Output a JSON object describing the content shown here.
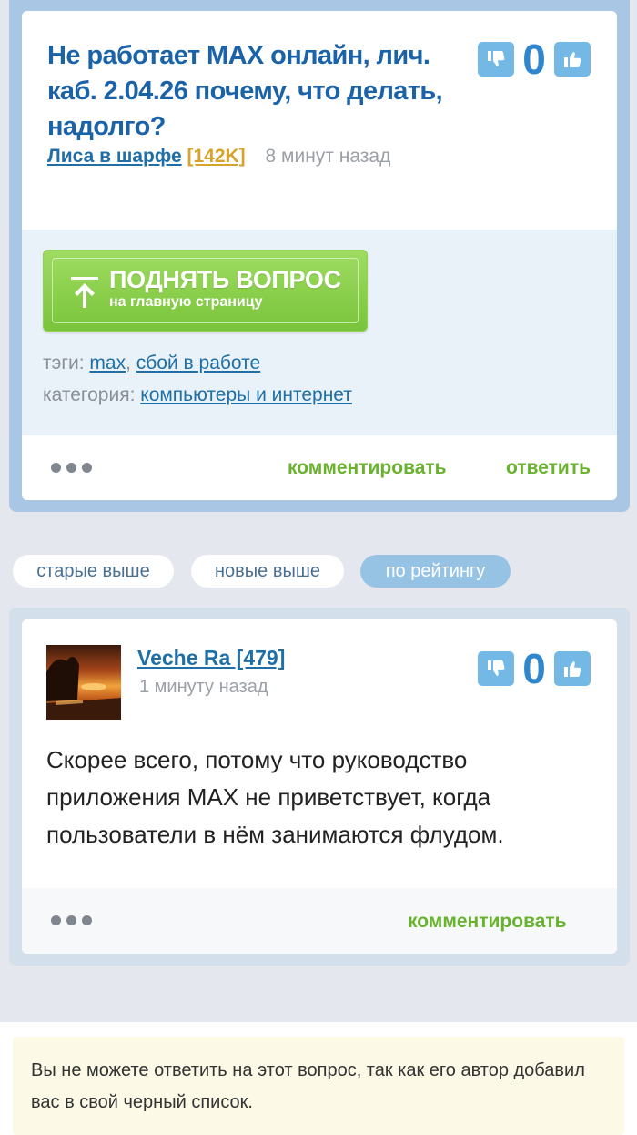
{
  "question": {
    "title": "Не работает MAX онлайн, лич. каб. 2.04.26 почему, что делать, надолго?",
    "author": "Лиса в шарфе",
    "author_karma": "[142K]",
    "time": "8 минут назад",
    "rating": "0",
    "raise_button": {
      "label": "ПОДНЯТЬ ВОПРОС",
      "sublabel": "на главную страницу"
    },
    "tags_label": "тэги:",
    "tags": [
      "max",
      "сбой в работе"
    ],
    "tags_separator": ",",
    "category_label": "категория:",
    "category": "компьютеры и интернет",
    "comment_label": "комментировать",
    "answer_label": "ответить"
  },
  "sort": {
    "options": [
      "старые выше",
      "новые выше",
      "по рейтингу"
    ],
    "active": "по рейтингу"
  },
  "answer": {
    "author": "Veche Ra [479]",
    "time": "1 минуту назад",
    "rating": "0",
    "text": "Скорее всего, потому что руководство приложения MAX не приветствует, когда пользователи в нём занимаются флудом.",
    "comment_label": "комментировать"
  },
  "notice": {
    "text": "Вы не можете ответить на этот вопрос, так как его автор добавил вас в свой черный список."
  },
  "colors": {
    "title_blue": "#1b63a8",
    "link_blue": "#1f6fa6",
    "action_green": "#69b22e",
    "button_green": "#79c43a",
    "karma_gold": "#d7a32a",
    "vote_blue": "#74b8e6"
  }
}
